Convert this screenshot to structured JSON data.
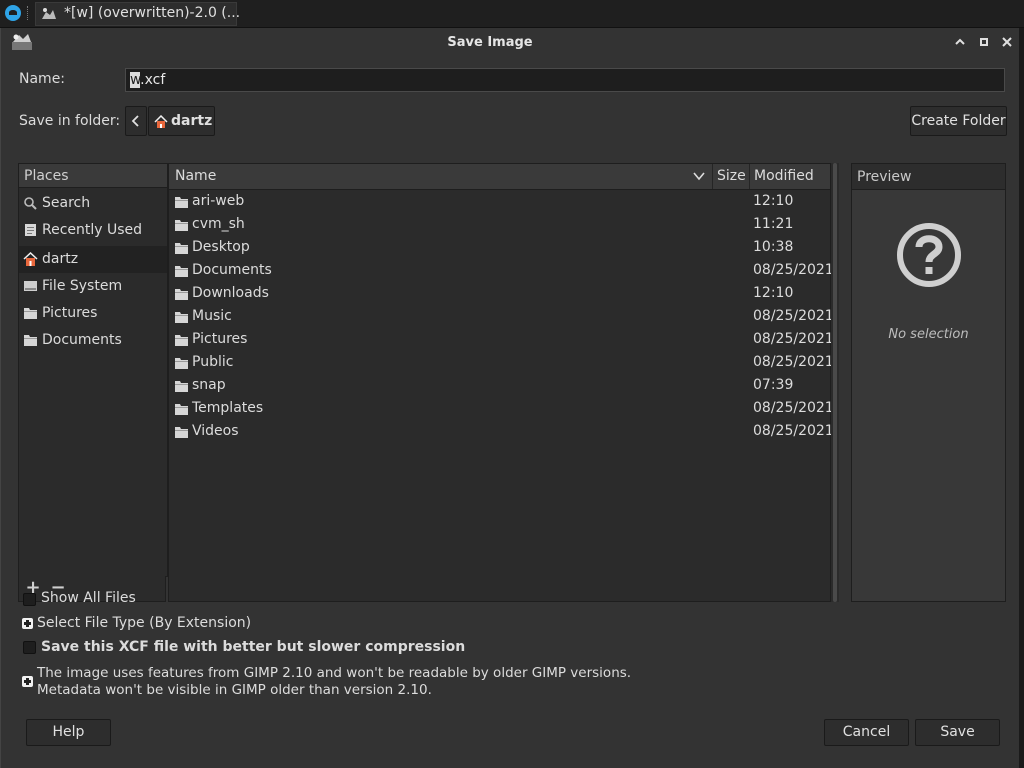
{
  "taskbar": {
    "task_title": "*[w] (overwritten)-2.0 (..."
  },
  "dialog": {
    "title": "Save Image",
    "name_label": "Name:",
    "name_value_selected": "w",
    "name_value_rest": ".xcf",
    "save_in_label": "Save in folder:",
    "path_back": "<",
    "path_current": "dartz",
    "create_folder": "Create Folder"
  },
  "places": {
    "header": "Places",
    "items": [
      {
        "label": "Search",
        "icon": "search-icon"
      },
      {
        "label": "Recently Used",
        "icon": "recent-icon"
      },
      {
        "label": "dartz",
        "icon": "home-icon"
      },
      {
        "label": "File System",
        "icon": "drive-icon"
      },
      {
        "label": "Pictures",
        "icon": "folder-icon"
      },
      {
        "label": "Documents",
        "icon": "folder-icon"
      }
    ],
    "add": "+",
    "remove": "−"
  },
  "files": {
    "columns": {
      "name": "Name",
      "size": "Size",
      "modified": "Modified"
    },
    "rows": [
      {
        "name": "ari-web",
        "modified": "12:10"
      },
      {
        "name": "cvm_sh",
        "modified": "11:21"
      },
      {
        "name": "Desktop",
        "modified": "10:38"
      },
      {
        "name": "Documents",
        "modified": "08/25/2021"
      },
      {
        "name": "Downloads",
        "modified": "12:10"
      },
      {
        "name": "Music",
        "modified": "08/25/2021"
      },
      {
        "name": "Pictures",
        "modified": "08/25/2021"
      },
      {
        "name": "Public",
        "modified": "08/25/2021"
      },
      {
        "name": "snap",
        "modified": "07:39"
      },
      {
        "name": "Templates",
        "modified": "08/25/2021"
      },
      {
        "name": "Videos",
        "modified": "08/25/2021"
      }
    ]
  },
  "preview": {
    "header": "Preview",
    "empty": "No selection"
  },
  "options": {
    "show_all": "Show All Files",
    "select_type": "Select File Type (By Extension)",
    "compression": "Save this XCF file with better but slower compression",
    "compat_line1": "The image uses features from GIMP 2.10 and won't be readable by older GIMP versions.",
    "compat_line2": "Metadata won't be visible in GIMP older than version 2.10."
  },
  "buttons": {
    "help": "Help",
    "cancel": "Cancel",
    "save": "Save"
  }
}
